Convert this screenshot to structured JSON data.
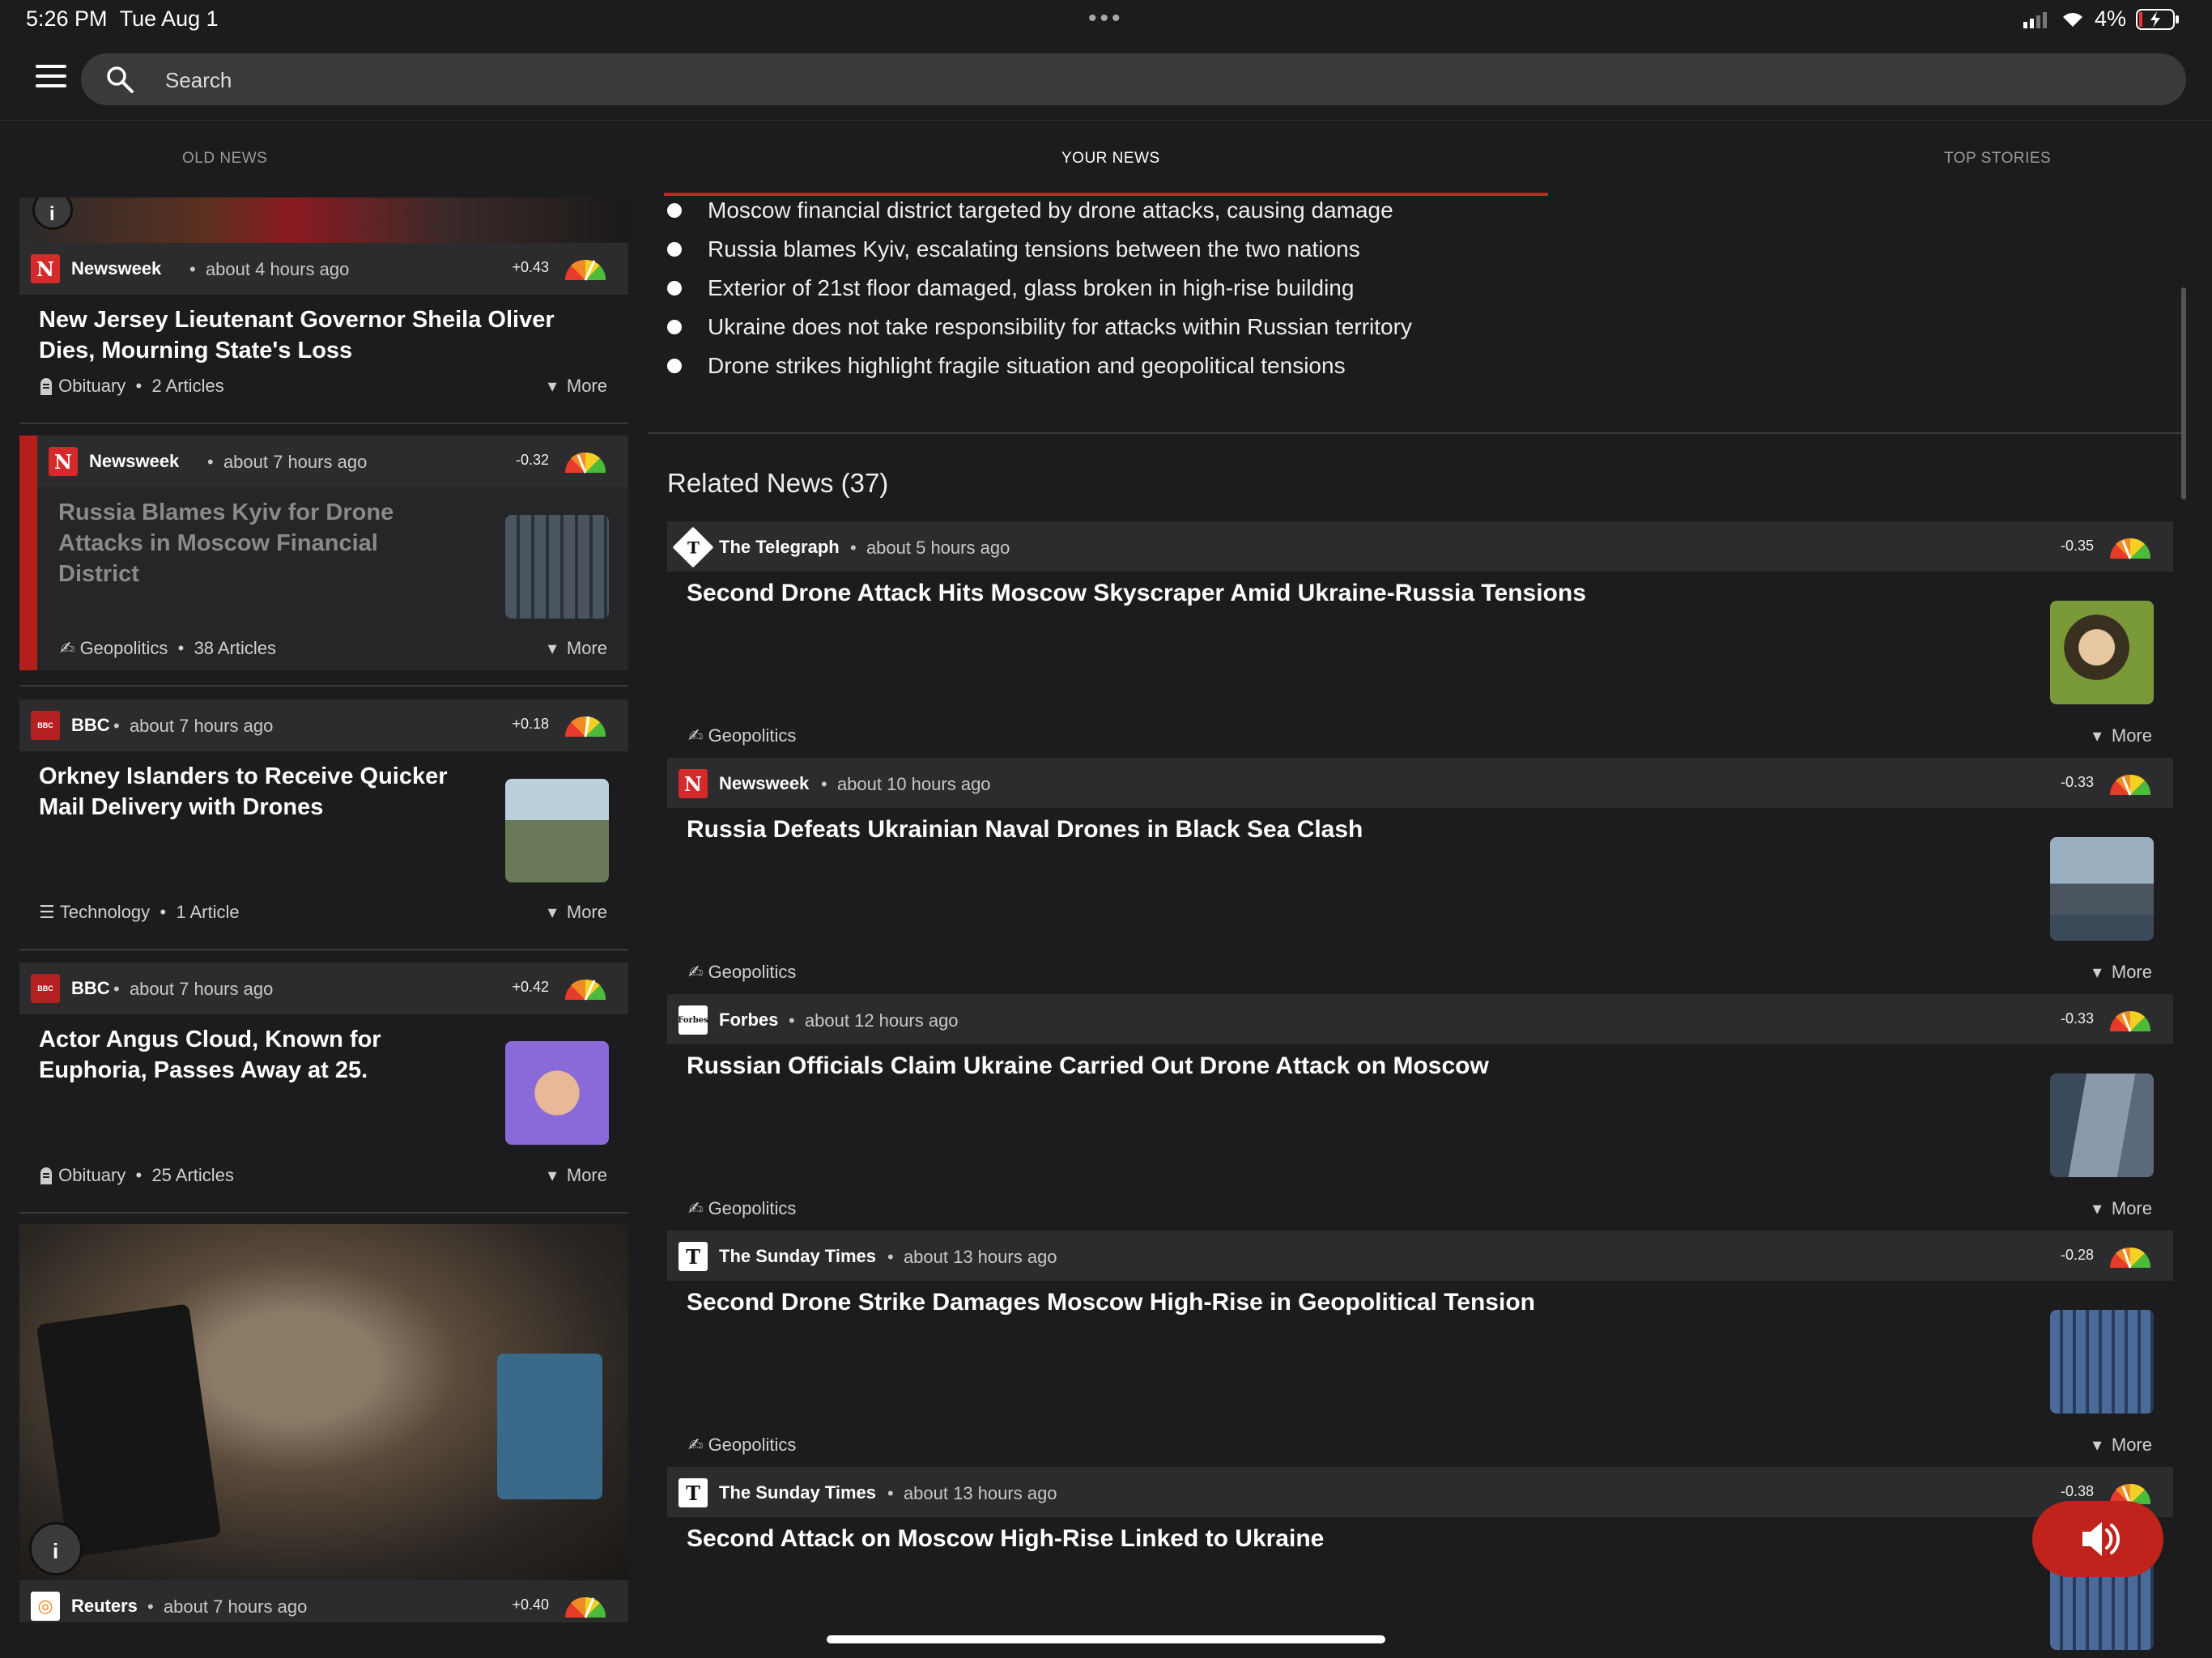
{
  "status": {
    "time": "5:26 PM",
    "date": "Tue Aug 1",
    "battery": "4%"
  },
  "search": {
    "placeholder": "Search"
  },
  "tabs": [
    "OLD NEWS",
    "YOUR NEWS",
    "TOP STORIES"
  ],
  "left_cards": [
    {
      "source": "Newsweek",
      "ago": "about 4 hours ago",
      "score": "+0.43",
      "title_lines": [
        "New Jersey Lieutenant Governor Sheila Oliver",
        "Dies, Mourning State's Loss"
      ],
      "category": "Obituary",
      "count": "2 Articles",
      "more": "More"
    },
    {
      "source": "Newsweek",
      "ago": "about 7 hours ago",
      "score": "-0.32",
      "title_lines": [
        "Russia Blames Kyiv for Drone",
        "Attacks in Moscow Financial",
        "District"
      ],
      "category": "Geopolitics",
      "count": "38 Articles",
      "more": "More"
    },
    {
      "source": "BBC",
      "ago": "about 7 hours ago",
      "score": "+0.18",
      "title_lines": [
        "Orkney Islanders to Receive Quicker",
        "Mail Delivery with Drones"
      ],
      "category": "Technology",
      "count": "1 Article",
      "more": "More"
    },
    {
      "source": "BBC",
      "ago": "about 7 hours ago",
      "score": "+0.42",
      "title_lines": [
        "Actor Angus Cloud, Known for",
        "Euphoria, Passes Away at 25."
      ],
      "category": "Obituary",
      "count": "25 Articles",
      "more": "More"
    },
    {
      "source": "Reuters",
      "ago": "about 7 hours ago",
      "score": "+0.40"
    }
  ],
  "bullets": [
    "Moscow financial district targeted by drone attacks, causing damage",
    "Russia blames Kyiv, escalating tensions between the two nations",
    "Exterior of 21st floor damaged, glass broken in high-rise building",
    "Ukraine does not take responsibility for attacks within Russian territory",
    "Drone strikes highlight fragile situation and geopolitical tensions"
  ],
  "related_header": "Related News (37)",
  "related": [
    {
      "source": "The Telegraph",
      "ago": "about 5 hours ago",
      "score": "-0.35",
      "title": "Second Drone Attack Hits Moscow Skyscraper Amid Ukraine-Russia Tensions",
      "category": "Geopolitics",
      "more": "More"
    },
    {
      "source": "Newsweek",
      "ago": "about 10 hours ago",
      "score": "-0.33",
      "title": "Russia Defeats Ukrainian Naval Drones in Black Sea Clash",
      "category": "Geopolitics",
      "more": "More"
    },
    {
      "source": "Forbes",
      "ago": "about 12 hours ago",
      "score": "-0.33",
      "title": "Russian Officials Claim Ukraine Carried Out Drone Attack on Moscow",
      "category": "Geopolitics",
      "more": "More"
    },
    {
      "source": "The Sunday Times",
      "ago": "about 13 hours ago",
      "score": "-0.28",
      "title": "Second Drone Strike Damages Moscow High-Rise in Geopolitical Tension",
      "category": "Geopolitics",
      "more": "More"
    },
    {
      "source": "The Sunday Times",
      "ago": "about 13 hours ago",
      "score": "-0.38",
      "title": "Second Attack on Moscow High-Rise Linked to Ukraine"
    }
  ],
  "colors": {
    "accent": "#c0261f",
    "card": "#2c2c2e",
    "background": "#1c1c1e"
  }
}
